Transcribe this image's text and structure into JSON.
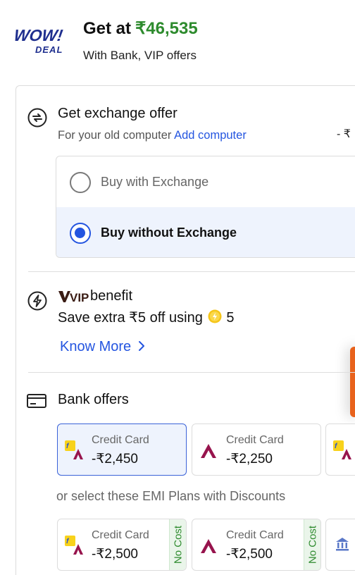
{
  "header": {
    "logo_line1": "WOW!",
    "logo_line2": "DEAL",
    "get_at_label": "Get at",
    "get_at_price": "₹46,535",
    "subtitle": "With Bank, VIP offers"
  },
  "exchange": {
    "title": "Get exchange offer",
    "subtitle_prefix": "For your old computer",
    "add_link": "Add computer",
    "edge_value": "- ₹",
    "options": [
      {
        "label": "Buy with Exchange",
        "selected": false
      },
      {
        "label": "Buy without Exchange",
        "selected": true
      }
    ]
  },
  "vip": {
    "logo_text": "VIP",
    "label": "benefit",
    "save_text": "Save extra ₹5 off using",
    "coins": "5",
    "know_more": "Know More"
  },
  "bank_offers": {
    "title": "Bank offers",
    "offers": [
      {
        "type": "Credit Card",
        "amount": "-₹2,450",
        "bank": "flipkart-axis",
        "selected": true
      },
      {
        "type": "Credit Card",
        "amount": "-₹2,250",
        "bank": "axis",
        "selected": false
      },
      {
        "type": "",
        "amount": "",
        "bank": "flipkart-axis",
        "selected": false
      }
    ],
    "emi_caption": "or select these EMI Plans with Discounts",
    "emi_offers": [
      {
        "type": "Credit Card",
        "amount": "-₹2,500",
        "bank": "flipkart-axis",
        "badge": "No Cost"
      },
      {
        "type": "Credit Card",
        "amount": "-₹2,500",
        "bank": "axis",
        "badge": "No Cost"
      },
      {
        "type": "",
        "amount": "",
        "bank": "bank-building",
        "badge": ""
      }
    ]
  },
  "colors": {
    "price_green": "#2e8b2e",
    "link_blue": "#2455e0",
    "selected_bg": "#eef3fd",
    "axis_maroon": "#97144d",
    "flipkart_yellow": "#f8d21b",
    "floating_orange": "#e8621c"
  },
  "icons": [
    "exchange-icon",
    "lightning-icon",
    "card-icon",
    "supercoin-icon",
    "chevron-right-icon",
    "bank-building-icon"
  ]
}
